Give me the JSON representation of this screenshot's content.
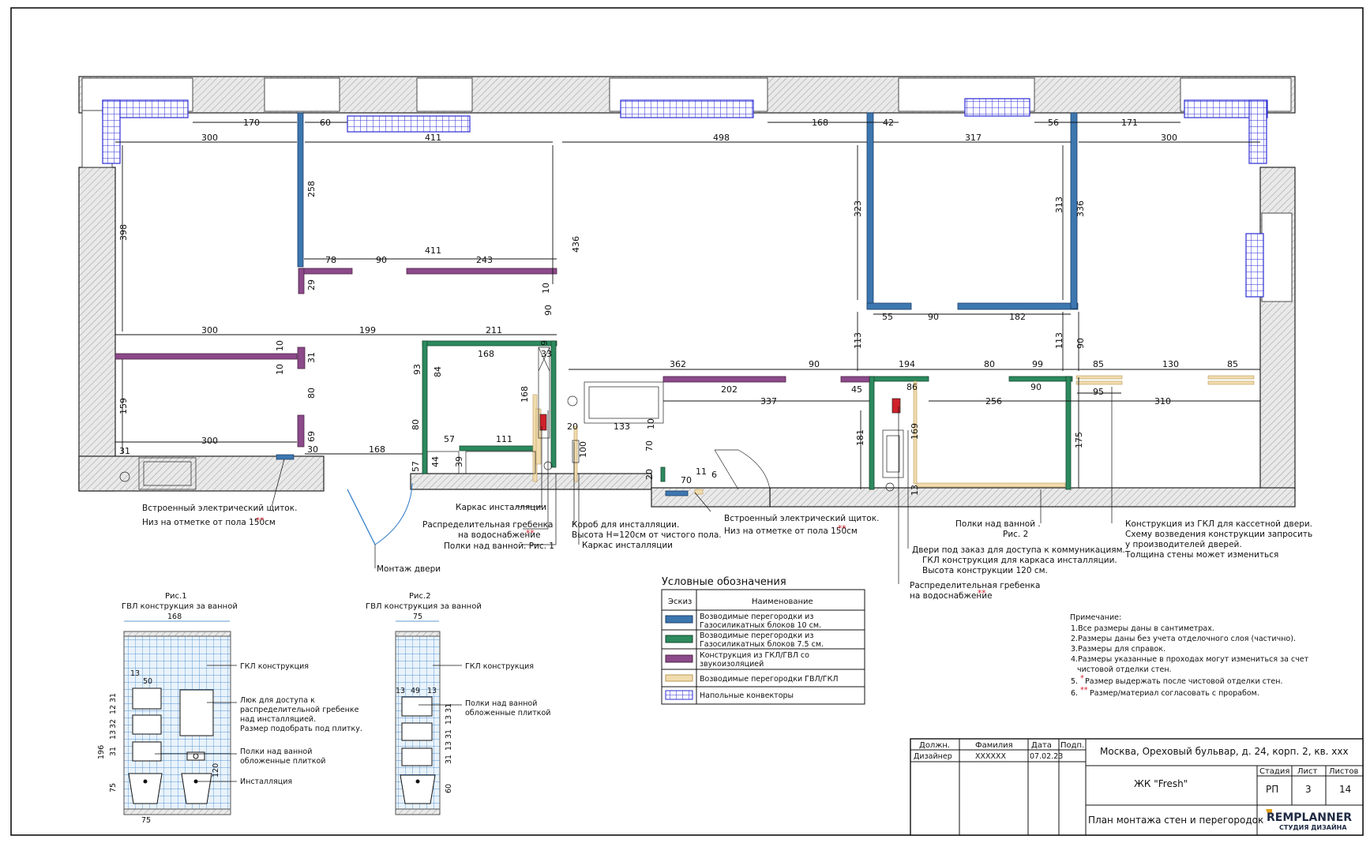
{
  "colors": {
    "gazosilikat10": "#3d77b0",
    "gazosilikat75": "#2c8a5e",
    "gkl_gvl_sound": "#8c4a8a",
    "gvl_gkl": "#f1dcae",
    "convector": "#2b2bd6",
    "accent_red": "#d0202a"
  },
  "dims": {
    "d170": "170",
    "d60": "60",
    "d168a": "168",
    "d42": "42",
    "d56": "56",
    "d171": "171",
    "d300a": "300",
    "d411a": "411",
    "d498": "498",
    "d317": "317",
    "d300b": "300",
    "d398": "398",
    "d258": "258",
    "d436": "436",
    "d323": "323",
    "d313": "313",
    "d336": "336",
    "d411b": "411",
    "d78": "78",
    "d90a": "90",
    "d243": "243",
    "d29": "29",
    "d10a": "10",
    "d90b": "90",
    "d55": "55",
    "d90c": "90",
    "d182": "182",
    "d300c": "300",
    "d199": "199",
    "d211": "211",
    "d10b": "10",
    "d31a": "31",
    "d10c": "10",
    "d9": "9",
    "d33": "33",
    "d168b": "168",
    "d93": "93",
    "d84": "84",
    "d168v": "168",
    "d80a": "80",
    "d159": "159",
    "d113a": "113",
    "d113b": "113",
    "d90d": "90",
    "d362": "362",
    "d90e": "90",
    "d194": "194",
    "d80b": "80",
    "d99": "99",
    "d85a": "85",
    "d130": "130",
    "d85b": "85",
    "d202": "202",
    "d45": "45",
    "d86": "86",
    "d90f": "90",
    "d95": "95",
    "d337": "337",
    "d256": "256",
    "d310": "310",
    "d80c": "80",
    "d57a": "57",
    "d111": "111",
    "d133": "133",
    "d20a": "20",
    "d10d": "10",
    "d300d": "300",
    "d69": "69",
    "d30": "30",
    "d168c": "168",
    "d31b": "31",
    "d57b": "57",
    "d44": "44",
    "d39": "39",
    "d100": "100",
    "d70a": "70",
    "d20b": "20",
    "d70b": "70",
    "d11": "11",
    "d6": "6",
    "d181": "181",
    "d169": "169",
    "d175": "175",
    "d13": "13"
  },
  "callouts": {
    "panel_left_1": "Встроенный электрический щиток.",
    "panel_left_2": "Низ на отметке от пола 150см",
    "stars": "**",
    "door_mount": "Монтаж двери",
    "frame_install_a": "Каркас инсталляции",
    "water_manifold_1": "Распределительная гребенка",
    "water_manifold_2": "на водоснабжение",
    "shelves_fig1": "Полки над ванной. Рис. 1",
    "box_install_1": "Короб для инсталляции.",
    "box_install_2": "Высота Н=120см от чистого пола.",
    "frame_install_b": "Каркас инсталляции",
    "panel_mid_1": "Встроенный электрический щиток.",
    "panel_mid_2": "Низ на отметке от пола 150см",
    "shelves_fig2_1": "Полки над ванной .",
    "shelves_fig2_2": "Рис. 2",
    "access_door_1": "Двери под заказ для доступа к коммуникациям.",
    "access_door_2": "ГКЛ конструкция для каркаса инсталляции.",
    "access_door_3": "Высота конструкции 120 см.",
    "manifold2_1": "Распределительная гребенка",
    "manifold2_2": "на водоснабжение",
    "cassette_1": "Конструкция из ГКЛ для кассетной двери.",
    "cassette_2": "Схему возведения конструкции запросить",
    "cassette_3": "у производителей дверей.",
    "cassette_4": "Толщина стены может измениться"
  },
  "legend": {
    "title": "Условные обозначения",
    "col_sketch": "Эскиз",
    "col_name": "Наименование",
    "rows": [
      {
        "l1": "Возводимые перегородки из",
        "l2": "Газосиликатных блоков  10 см."
      },
      {
        "l1": "Возводимые перегородки из",
        "l2": "Газосиликатных блоков  7.5 см."
      },
      {
        "l1": "Конструкция из ГКЛ/ГВЛ со",
        "l2": "звукоизоляцией"
      },
      {
        "l1": "Возводимые перегородки ГВЛ/ГКЛ",
        "l2": ""
      },
      {
        "l1": "Напольные конвекторы",
        "l2": ""
      }
    ]
  },
  "notes": {
    "title": "Примечание:",
    "n1": "1.Все размеры даны в сантиметрах.",
    "n2": "2.Размеры даны без учета отделочного слоя (частично).",
    "n3": "3.Размеры для справок.",
    "n4a": "4.Размеры указанные  в проходах могут измениться за счет",
    "n4b": "чистовой отделки стен.",
    "n5_prefix": "5.",
    "n5_star": "*",
    "n5_text": "Размер выдержать после чистовой отделки стен.",
    "n6_prefix": "6.",
    "n6_star": "**",
    "n6_text": "Размер/материал согласовать с прорабом."
  },
  "fig1": {
    "title1": "Рис.1",
    "title2": "ГВЛ конструкция за ванной",
    "w168": "168",
    "d13": "13",
    "d50": "50",
    "h196": "196",
    "h75": "75",
    "s31a": "31",
    "s12": "12",
    "s32": "32",
    "s13": "13",
    "s31b": "31",
    "s120": "120",
    "w75": "75",
    "lbl_gkl": "ГКЛ конструкция",
    "lbl_hatch_1": "Люк для доступа к",
    "lbl_hatch_2": "распределительной гребенке",
    "lbl_hatch_3": "над инсталляцией.",
    "lbl_hatch_4": "Размер подобрать под плитку.",
    "lbl_shelves_1": "Полки над ванной",
    "lbl_shelves_2": "обложенные плиткой",
    "lbl_install": "Инсталляция"
  },
  "fig2": {
    "title1": "Рис.2",
    "title2": "ГВЛ конструкция за ванной",
    "w75": "75",
    "d13": "13",
    "d49": "49",
    "d13b": "13",
    "s31a": "31",
    "s13a": "13",
    "s31b": "31",
    "s13b": "13",
    "s31c": "31",
    "s60": "60",
    "lbl_gkl": "ГКЛ конструкция",
    "lbl_shelves_1": "Полки над ванной",
    "lbl_shelves_2": "обложенные плиткой"
  },
  "titleblock": {
    "h_position": "Должн.",
    "h_surname": "Фамилия",
    "h_date": "Дата",
    "h_sign": "Подп.",
    "position": "Дизайнер",
    "surname": "XXXXXX",
    "date": "07.02.23",
    "address": "Москва, Ореховый бульвар, д. 24, корп. 2, кв. ххх",
    "project": "ЖК \"Fresh\"",
    "h_stage": "Стадия",
    "h_sheet": "Лист",
    "h_sheets": "Листов",
    "stage": "РП",
    "sheet": "3",
    "sheets": "14",
    "drawing_title": "План монтажа стен и перегородок",
    "logo_main": "REMPLANNER",
    "logo_sub": "СТУДИЯ ДИЗАЙНА"
  }
}
